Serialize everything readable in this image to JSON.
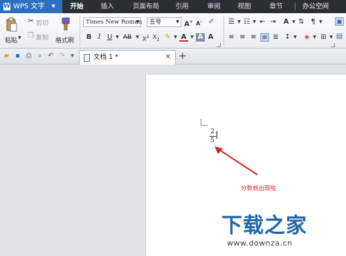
{
  "app": {
    "name": "WPS 文字"
  },
  "menu": {
    "tabs": [
      "开始",
      "插入",
      "页面布局",
      "引用",
      "审阅",
      "视图",
      "章节",
      "办公空间"
    ]
  },
  "ribbon": {
    "paste_label": "粘贴",
    "cut_label": "剪切",
    "copy_label": "复制",
    "format_painter_label": "格式刷",
    "font_name": "Times New Roman",
    "font_size": "五号"
  },
  "document": {
    "tab_title": "文档 1 *",
    "fraction": {
      "numerator": "2",
      "denominator": "5"
    },
    "annotation": "分数就出现啦"
  },
  "watermark": {
    "main": "下载之家",
    "sub": "www.downza.cn"
  },
  "colors": {
    "app_blue": "#2d6fc0",
    "menubar": "#2a2e36",
    "annotation_red": "#d2272a",
    "watermark_blue": "#2167a8"
  }
}
